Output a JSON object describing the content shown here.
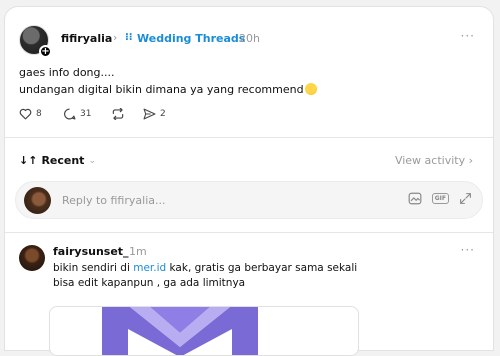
{
  "post": {
    "username": "fifiryalia",
    "community": "Wedding Threads",
    "time": "20h",
    "line1": "gaes info dong....",
    "line2": "undangan digital bikin dimana ya yang recommend",
    "likes": "8",
    "replies": "31",
    "shares": "2"
  },
  "sort": {
    "label": "Recent",
    "view_activity": "View activity"
  },
  "reply": {
    "placeholder": "Reply to fifiryalia..."
  },
  "comment": {
    "username": "fairysunset_",
    "time": "1m",
    "text_before": "bikin sendiri di ",
    "link": "mer.id",
    "text_after": " kak, gratis ga berbayar sama sekali",
    "line2": "bisa edit kapanpun , ga ada limitnya"
  },
  "more_glyph": "···",
  "colors": {
    "accent": "#1a8cd8",
    "muted": "#999999"
  }
}
